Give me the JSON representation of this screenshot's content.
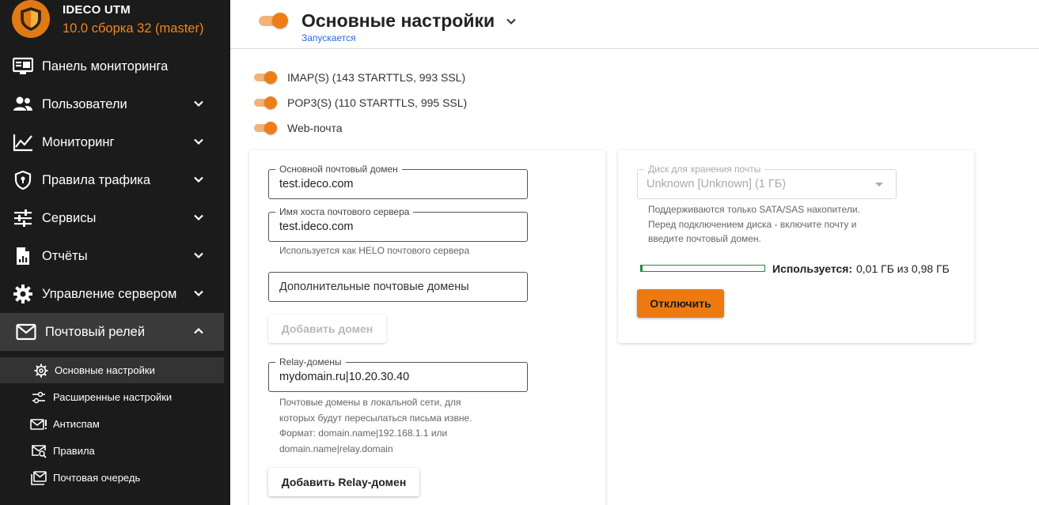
{
  "brand": {
    "title": "IDECO UTM",
    "version": "10.0 сборка 32 (master)",
    "logo_icon": "shield-icon",
    "accent": "#e27a14"
  },
  "sidebar": {
    "items": [
      {
        "label": "Панель мониторинга",
        "icon": "dashboard-icon",
        "expandable": false
      },
      {
        "label": "Пользователи",
        "icon": "users-icon",
        "expandable": true
      },
      {
        "label": "Мониторинг",
        "icon": "chart-line-icon",
        "expandable": true
      },
      {
        "label": "Правила трафика",
        "icon": "shield-icon",
        "expandable": true
      },
      {
        "label": "Сервисы",
        "icon": "sliders-icon",
        "expandable": true
      },
      {
        "label": "Отчёты",
        "icon": "report-icon",
        "expandable": true
      },
      {
        "label": "Управление сервером",
        "icon": "gear-icon",
        "expandable": true
      },
      {
        "label": "Почтовый релей",
        "icon": "mail-icon",
        "expandable": true,
        "expanded": true
      }
    ],
    "subitems": [
      {
        "label": "Основные настройки",
        "icon": "gear-icon",
        "active": true
      },
      {
        "label": "Расширенные настройки",
        "icon": "sliders-icon"
      },
      {
        "label": "Антиспам",
        "icon": "mail-alert-icon"
      },
      {
        "label": "Правила",
        "icon": "mail-search-icon"
      },
      {
        "label": "Почтовая очередь",
        "icon": "mail-queue-icon"
      }
    ]
  },
  "header": {
    "title": "Основные настройки",
    "status": "Запускается",
    "enabled": true
  },
  "toggles": [
    {
      "label": "IMAP(S) (143 STARTTLS, 993 SSL)",
      "on": true
    },
    {
      "label": "POP3(S) (110 STARTTLS, 995 SSL)",
      "on": true
    },
    {
      "label": "Web-почта",
      "on": true
    }
  ],
  "left_card": {
    "main_domain": {
      "label": "Основной почтовый домен",
      "value": "test.ideco.com"
    },
    "hostname": {
      "label": "Имя хоста почтового сервера",
      "value": "test.ideco.com",
      "hint": "Используется как HELO почтового сервера"
    },
    "extra_domains": {
      "placeholder": "Дополнительные почтовые домены"
    },
    "add_domain_button": "Добавить домен",
    "relay": {
      "label": "Relay-домены",
      "value": "mydomain.ru|10.20.30.40",
      "hint_lines": [
        "Почтовые домены в локальной сети, для",
        "которых будут пересылаться письма извне.",
        "Формат: domain.name|192.168.1.1 или",
        "domain.name|relay.domain"
      ]
    },
    "add_relay_button": "Добавить Relay-домен"
  },
  "right_card": {
    "disk": {
      "label": "Диск для хранения почты",
      "value": "Unknown [Unknown] (1 ГБ)"
    },
    "hint_lines": [
      "Поддерживаются только SATA/SAS накопители.",
      "Перед подключением диска - включите почту и",
      "введите почтовый домен."
    ],
    "usage": {
      "label": "Используется:",
      "value": "0,01 ГБ из 0,98 ГБ",
      "fraction": 0.0102
    },
    "disable_button": "Отключить"
  },
  "colors": {
    "accent": "#ef7d17",
    "progress": "#1e8b3a",
    "link": "#2a6bd8",
    "sidebar_bg": "#1b1b1b"
  }
}
